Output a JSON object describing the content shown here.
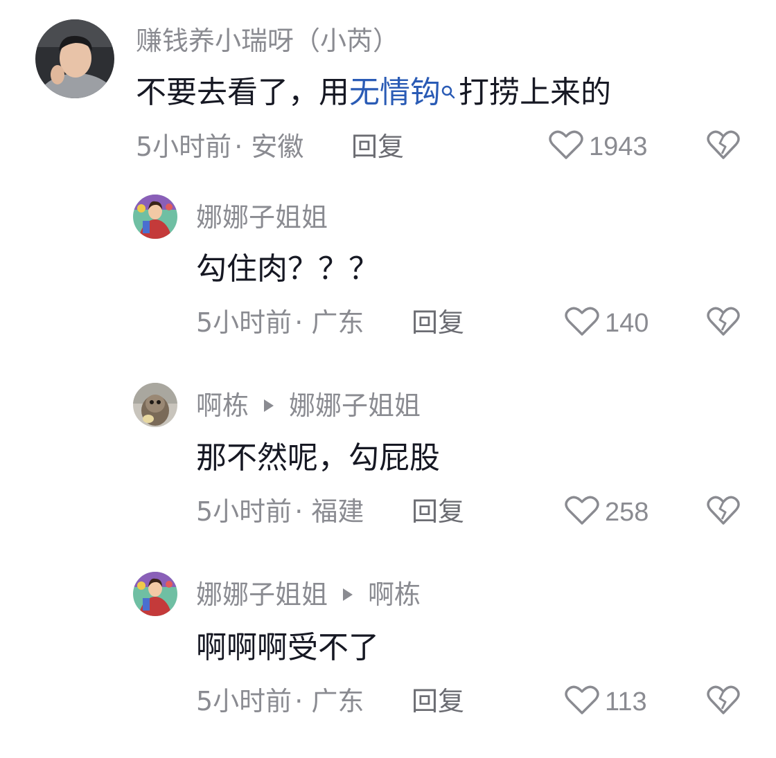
{
  "comments": [
    {
      "username": "赚钱养小瑞呀（小芮）",
      "content_before": "不要去看了，用",
      "content_link": "无情钩",
      "content_after": "打捞上来的",
      "time": "5小时前",
      "location": "· 安徽",
      "reply_label": "回复",
      "likes": "1943"
    },
    {
      "username": "娜娜子姐姐",
      "content": "勾住肉？？？",
      "time": "5小时前",
      "location": "· 广东",
      "reply_label": "回复",
      "likes": "140"
    },
    {
      "username": "啊栋",
      "reply_to": "娜娜子姐姐",
      "content": "那不然呢，勾屁股",
      "time": "5小时前",
      "location": "· 福建",
      "reply_label": "回复",
      "likes": "258"
    },
    {
      "username": "娜娜子姐姐",
      "reply_to": "啊栋",
      "content": "啊啊啊受不了",
      "time": "5小时前",
      "location": "· 广东",
      "reply_label": "回复",
      "likes": "113"
    }
  ],
  "icons": {
    "like": "heart-outline-icon",
    "dislike": "broken-heart-icon",
    "search": "search-icon",
    "reply_arrow": "triangle-right-icon"
  },
  "colors": {
    "link": "#2a5bb5",
    "secondary_text": "#8a8b91",
    "primary_text": "#161823"
  }
}
